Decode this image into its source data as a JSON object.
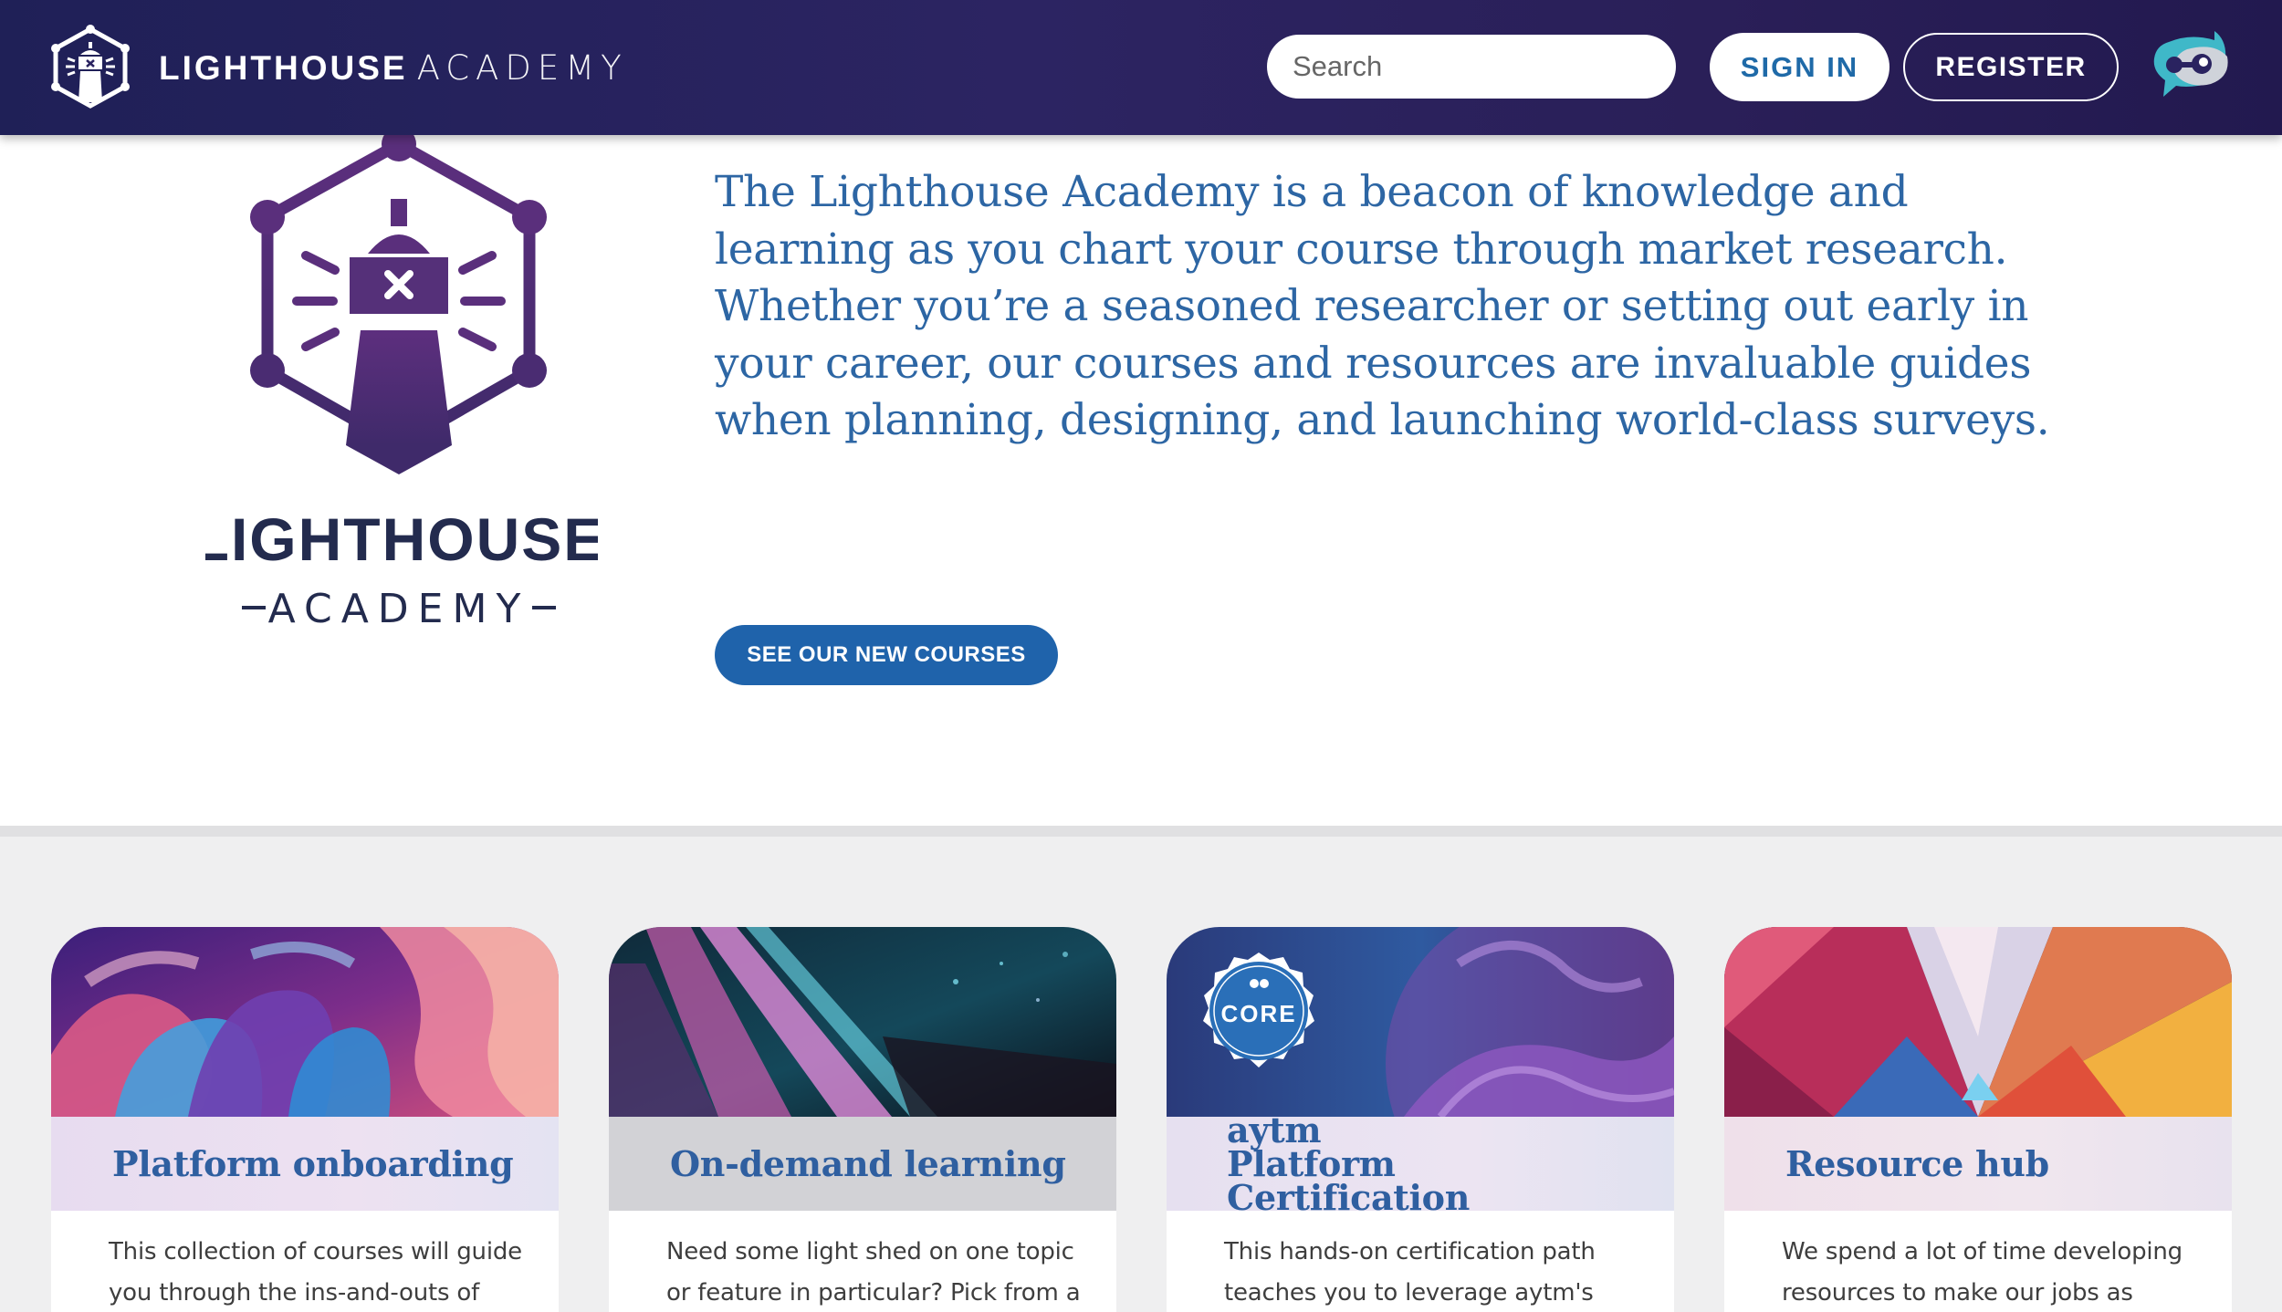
{
  "header": {
    "brand_bold": "LIGHTHOUSE",
    "brand_thin": "ACADEMY",
    "search_placeholder": "Search",
    "signin_label": "SIGN IN",
    "register_label": "REGISTER"
  },
  "hero": {
    "logo_wordmark_top": "LIGHTHOUSE",
    "logo_wordmark_bottom": "ACADEMY",
    "paragraph": "The Lighthouse Academy is a beacon of knowledge and learning as you chart your course through market research. Whether you’re a seasoned researcher or setting out early in your career, our courses and resources are invaluable guides when planning, designing, and launching world-class surveys.",
    "cta_label": "SEE OUR NEW COURSES"
  },
  "cards": [
    {
      "title": "Platform onboarding",
      "description": "This collection of courses will guide you through the ins-and-outs of"
    },
    {
      "title": "On-demand learning",
      "description": "Need some light shed on one topic or feature in particular? Pick from a"
    },
    {
      "title": "aytm Platform Certification",
      "badge": "CORE",
      "description": "This hands-on certification path teaches you to leverage aytm's"
    },
    {
      "title": "Resource hub",
      "description": "We spend a lot of time developing resources to make our jobs as"
    }
  ],
  "colors": {
    "header_bg": "#241f5a",
    "brand_purple": "#4b2a6e",
    "link_blue": "#2d66a4",
    "cta_blue": "#1f63ab"
  }
}
